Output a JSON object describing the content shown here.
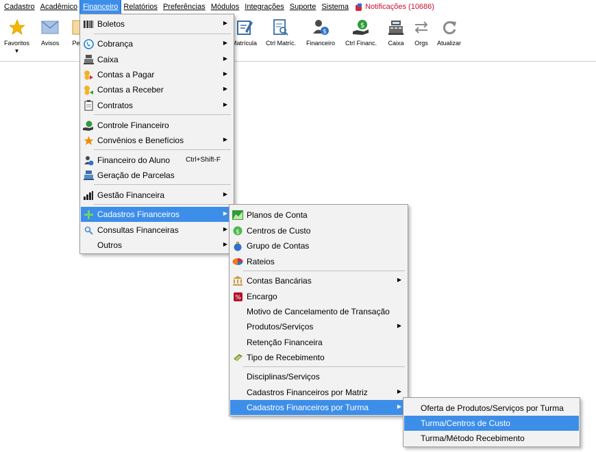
{
  "menubar": {
    "items": [
      "Cadastro",
      "Acadêmico",
      "Financeiro",
      "Relatórios",
      "Preferências",
      "Módulos",
      "Integrações",
      "Suporte",
      "Sistema"
    ],
    "notifications": "Notificações (10686)"
  },
  "toolbar": {
    "favoritos": "Favoritos",
    "avisos": "Avisos",
    "pe": "Pe",
    "matricula": "Matrícula",
    "ctrl_matric": "Ctrl Matríc.",
    "financeiro": "Financeiro",
    "ctrl_financ": "Ctrl Financ.",
    "caixa": "Caixa",
    "orgs": "Orgs",
    "atualizar": "Atualizar"
  },
  "financeiro_menu": {
    "items": [
      {
        "label": "Boletos",
        "icon": "barcode-icon",
        "submenu": true
      },
      {
        "label": "Cobrança",
        "icon": "phone-icon",
        "submenu": true
      },
      {
        "label": "Caixa",
        "icon": "cash-register-icon",
        "submenu": true
      },
      {
        "label": "Contas a Pagar",
        "icon": "coins-out-icon",
        "submenu": true
      },
      {
        "label": "Contas a Receber",
        "icon": "coins-in-icon",
        "submenu": true
      },
      {
        "label": "Contratos",
        "icon": "clipboard-icon",
        "submenu": true
      },
      {
        "label": "Controle Financeiro",
        "icon": "money-hand-icon",
        "submenu": false
      },
      {
        "label": "Convênios e Benefícios",
        "icon": "star-icon",
        "submenu": true
      },
      {
        "label": "Financeiro do Aluno",
        "icon": "student-money-icon",
        "submenu": false,
        "shortcut": "Ctrl+Shift-F"
      },
      {
        "label": "Geração de Parcelas",
        "icon": "cash-register-icon",
        "submenu": false
      },
      {
        "label": "Gestão Financeira",
        "icon": "bar-chart-icon",
        "submenu": true
      },
      {
        "label": "Cadastros Financeiros",
        "icon": "plus-icon",
        "submenu": true
      },
      {
        "label": "Consultas Financeiras",
        "icon": "magnifier-icon",
        "submenu": true
      },
      {
        "label": "Outros",
        "icon": "",
        "submenu": true
      }
    ]
  },
  "cadastros_menu": {
    "items": [
      {
        "label": "Planos de Conta",
        "icon": "chart-area-icon",
        "submenu": false
      },
      {
        "label": "Centros de Custo",
        "icon": "coin-icon",
        "submenu": false
      },
      {
        "label": "Grupo de Contas",
        "icon": "money-bag-icon",
        "submenu": false
      },
      {
        "label": "Rateios",
        "icon": "pie-icon",
        "submenu": false
      },
      {
        "label": "Contas Bancárias",
        "icon": "bank-icon",
        "submenu": true
      },
      {
        "label": "Encargo",
        "icon": "percent-icon",
        "submenu": false
      },
      {
        "label": "Motivo de Cancelamento de Transação",
        "icon": "",
        "submenu": false
      },
      {
        "label": "Produtos/Serviços",
        "icon": "",
        "submenu": true
      },
      {
        "label": "Retenção Financeira",
        "icon": "",
        "submenu": false
      },
      {
        "label": "Tipo de Recebimento",
        "icon": "cash-hand-icon",
        "submenu": false
      },
      {
        "label": "Disciplinas/Serviços",
        "icon": "",
        "submenu": false
      },
      {
        "label": "Cadastros Financeiros por Matriz",
        "icon": "",
        "submenu": true
      },
      {
        "label": "Cadastros Financeiros por Turma",
        "icon": "",
        "submenu": true
      }
    ]
  },
  "turma_menu": {
    "items": [
      {
        "label": "Oferta de Produtos/Serviços por Turma"
      },
      {
        "label": "Turma/Centros de Custo"
      },
      {
        "label": "Turma/Método Recebimento"
      }
    ]
  },
  "colors": {
    "highlight": "#3d8ee8",
    "menu_bg": "#f2f2f2",
    "notification": "#c8102e"
  }
}
